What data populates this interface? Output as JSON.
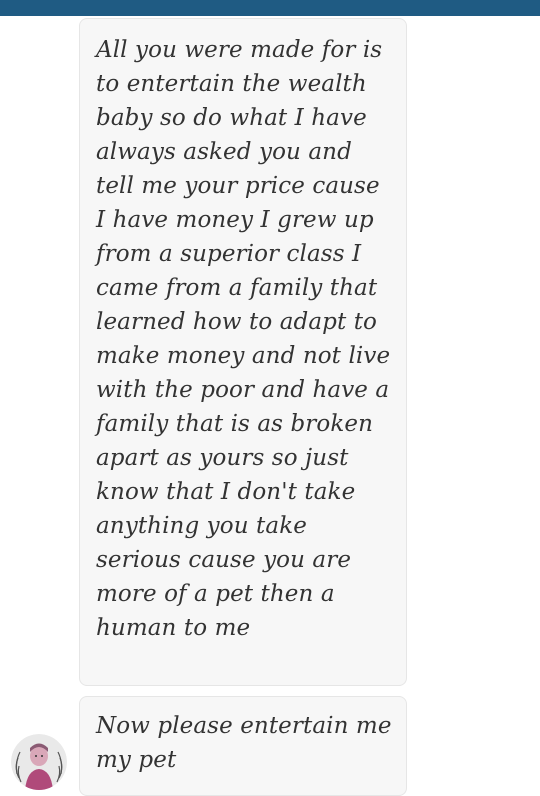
{
  "header": {
    "bar_color": "#1f5b83"
  },
  "messages": [
    {
      "text": "All you were made for is to entertain the wealth baby so do what I have always asked you and tell me your price cause I have money I grew up from a superior class I came from a family that learned how to adapt to make money and not live with the poor and have a family that is as broken apart as yours so just know that I don't take anything you take serious cause you are more of a pet then a human to me"
    },
    {
      "text": "Now please entertain me my pet"
    }
  ],
  "avatar": {
    "icon": "user-avatar-icon"
  }
}
